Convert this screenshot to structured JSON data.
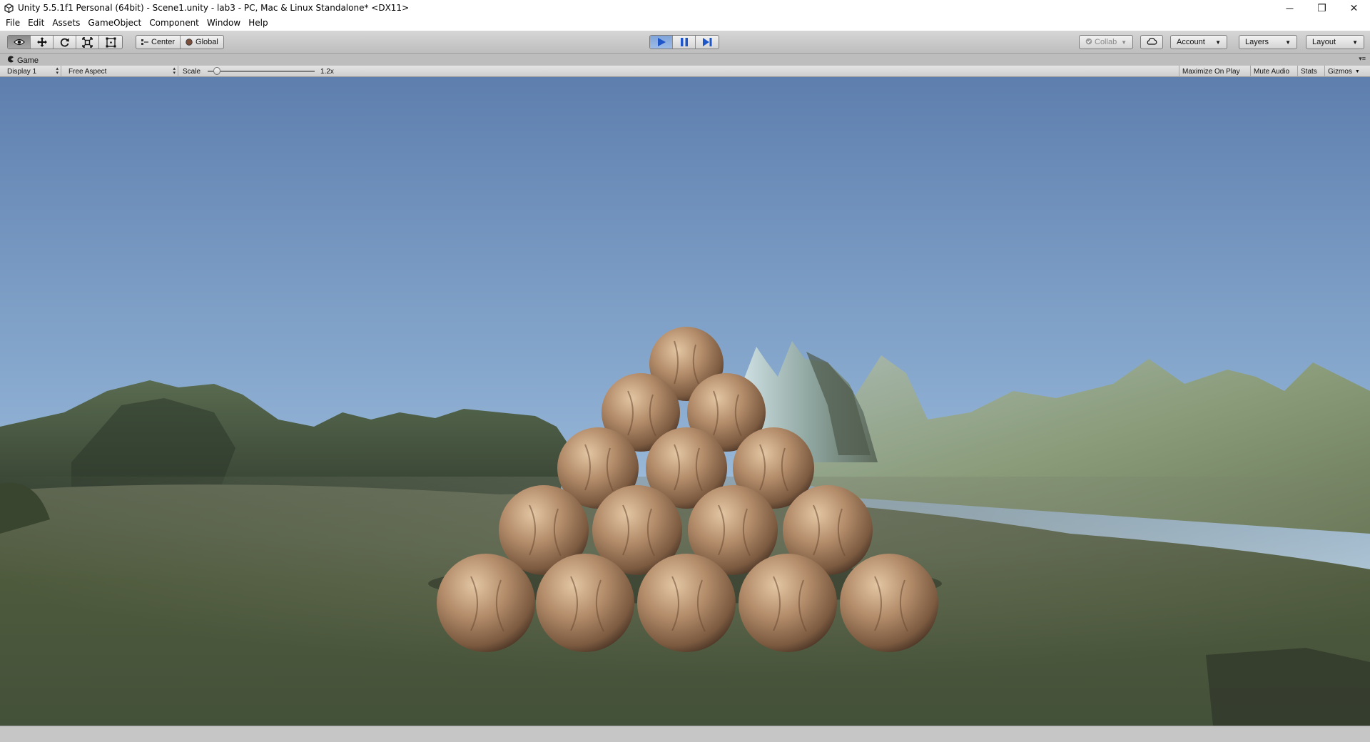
{
  "window": {
    "title": "Unity 5.5.1f1 Personal (64bit) - Scene1.unity - lab3 - PC, Mac & Linux Standalone* <DX11>",
    "controls": {
      "minimize": "─",
      "restore": "❐",
      "close": "✕"
    }
  },
  "menu": {
    "items": [
      "File",
      "Edit",
      "Assets",
      "GameObject",
      "Component",
      "Window",
      "Help"
    ]
  },
  "toolbar": {
    "tools": [
      {
        "name": "view",
        "icon": "eye-icon",
        "active": true
      },
      {
        "name": "move",
        "icon": "move-arrows-icon",
        "active": false
      },
      {
        "name": "rotate",
        "icon": "rotate-icon",
        "active": false
      },
      {
        "name": "scale",
        "icon": "scale-icon",
        "active": false
      },
      {
        "name": "rect",
        "icon": "rect-transform-icon",
        "active": false
      }
    ],
    "pivot_mode": "Center",
    "pivot_rotation": "Global",
    "play": {
      "playing": true,
      "paused": false
    },
    "collab_label": "Collab",
    "account_label": "Account",
    "layers_label": "Layers",
    "layout_label": "Layout",
    "accent_color": "#3b6fd1"
  },
  "game_tab": {
    "label": "Game",
    "icon": "pacman-game-icon"
  },
  "game_controls": {
    "display": "Display 1",
    "aspect": "Free Aspect",
    "scale_label": "Scale",
    "scale_value": "1.2x",
    "scale_fraction": 0.06,
    "maximize_on_play": "Maximize On Play",
    "mute_audio": "Mute Audio",
    "stats": "Stats",
    "gizmos": "Gizmos"
  },
  "scene": {
    "description_elements": [
      "sky",
      "terrain-mountains",
      "ground",
      "sphere-pyramid"
    ],
    "sky_top_color": "#5e83b3",
    "sky_horizon_color": "#bcd3e4",
    "ground_color": "#4d5a3a",
    "sphere_color": "#b48d6b",
    "pyramid_rows": [
      1,
      2,
      3,
      4,
      5
    ]
  }
}
